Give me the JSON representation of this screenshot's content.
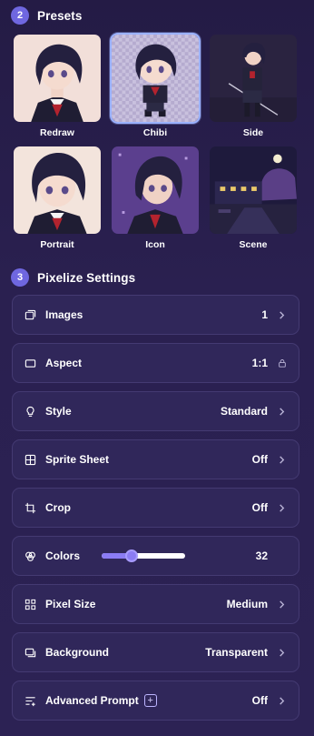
{
  "presets_section": {
    "step": "2",
    "title": "Presets",
    "items": [
      {
        "label": "Redraw",
        "selected": false
      },
      {
        "label": "Chibi",
        "selected": true
      },
      {
        "label": "Side",
        "selected": false
      },
      {
        "label": "Portrait",
        "selected": false
      },
      {
        "label": "Icon",
        "selected": false
      },
      {
        "label": "Scene",
        "selected": false
      }
    ]
  },
  "settings_section": {
    "step": "3",
    "title": "Pixelize Settings",
    "rows": {
      "images": {
        "label": "Images",
        "value": "1",
        "icon": "images-icon"
      },
      "aspect": {
        "label": "Aspect",
        "value": "1:1",
        "icon": "aspect-icon",
        "locked": true
      },
      "style": {
        "label": "Style",
        "value": "Standard",
        "icon": "lightbulb-icon"
      },
      "sprite_sheet": {
        "label": "Sprite Sheet",
        "value": "Off",
        "icon": "grid-icon"
      },
      "crop": {
        "label": "Crop",
        "value": "Off",
        "icon": "crop-icon"
      },
      "colors": {
        "label": "Colors",
        "value": "32",
        "icon": "palette-icon",
        "slider_fraction": 0.36
      },
      "pixel_size": {
        "label": "Pixel Size",
        "value": "Medium",
        "icon": "pixel-grid-icon"
      },
      "background": {
        "label": "Background",
        "value": "Transparent",
        "icon": "background-icon"
      },
      "advanced_prompt": {
        "label": "Advanced Prompt",
        "value": "Off",
        "icon": "prompt-icon",
        "badge": "+"
      }
    }
  },
  "colors": {
    "accent": "#6f67e0",
    "selected_border": "#9bb2ff",
    "row_bg": "#30275a",
    "slider_fill": "#8b7cf4"
  }
}
